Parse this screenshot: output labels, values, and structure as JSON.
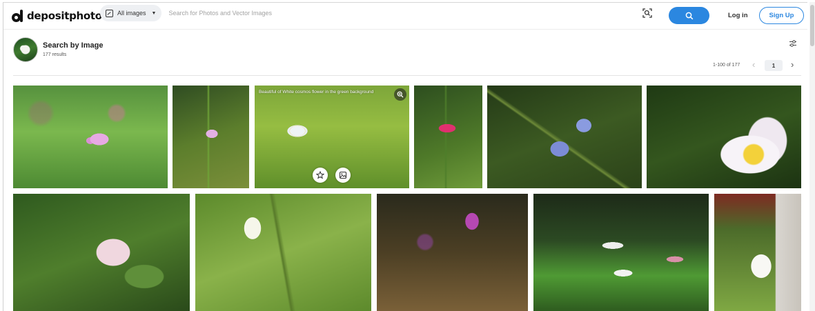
{
  "brand": {
    "logo_text": "depositphotos"
  },
  "search": {
    "filter_label": "All images",
    "placeholder": "Search for Photos and Vector Images"
  },
  "header": {
    "login_label": "Log in",
    "signup_label": "Sign Up"
  },
  "results": {
    "title": "Search by Image",
    "count": "177 results",
    "range": "1-100 of 177",
    "current_page": "1"
  },
  "tiles": [
    {
      "id": "t1"
    },
    {
      "id": "t2"
    },
    {
      "id": "t3",
      "title": "Beautiful of White cosmos flower in the green background"
    },
    {
      "id": "t4"
    },
    {
      "id": "t5"
    },
    {
      "id": "t6"
    },
    {
      "id": "t7"
    },
    {
      "id": "t8"
    },
    {
      "id": "t9"
    },
    {
      "id": "t10"
    },
    {
      "id": "t11"
    }
  ],
  "colors": {
    "accent": "#2b87e0"
  },
  "icons": [
    "search-icon",
    "visual-search-icon",
    "settings-icon",
    "zoom-icon",
    "star-icon",
    "similar-images-icon",
    "image-filter-icon",
    "chevron-left-icon",
    "chevron-right-icon",
    "caret-down-icon"
  ]
}
